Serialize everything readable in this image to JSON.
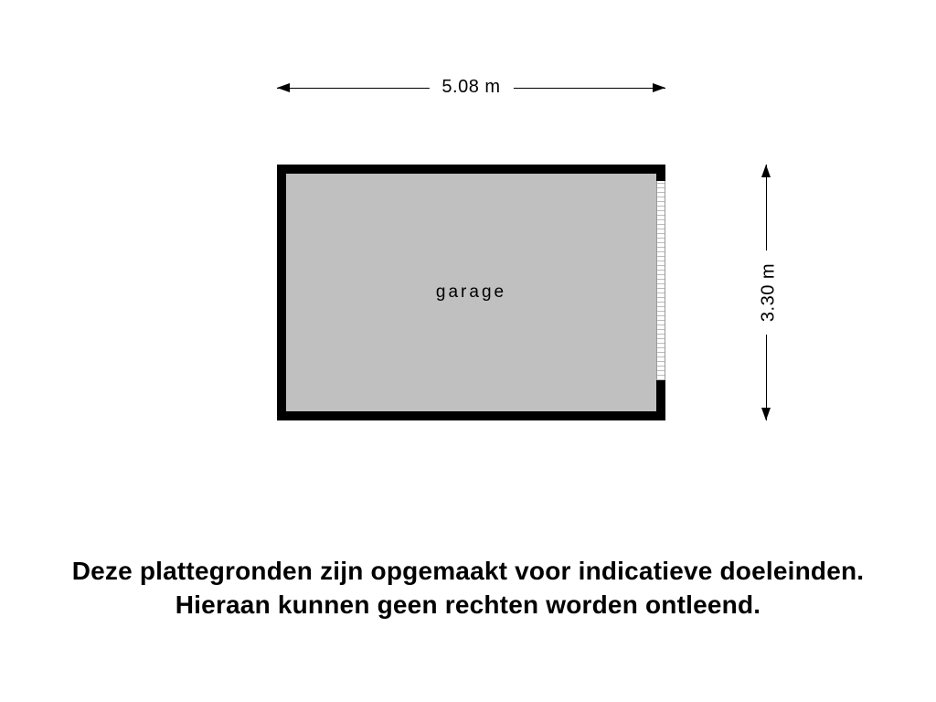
{
  "dimensions": {
    "width_label": "5.08 m",
    "height_label": "3.30 m"
  },
  "room": {
    "label": "garage"
  },
  "disclaimer": {
    "line1": "Deze plattegronden zijn opgemaakt voor indicatieve doeleinden.",
    "line2": "Hieraan kunnen geen rechten worden ontleend."
  }
}
